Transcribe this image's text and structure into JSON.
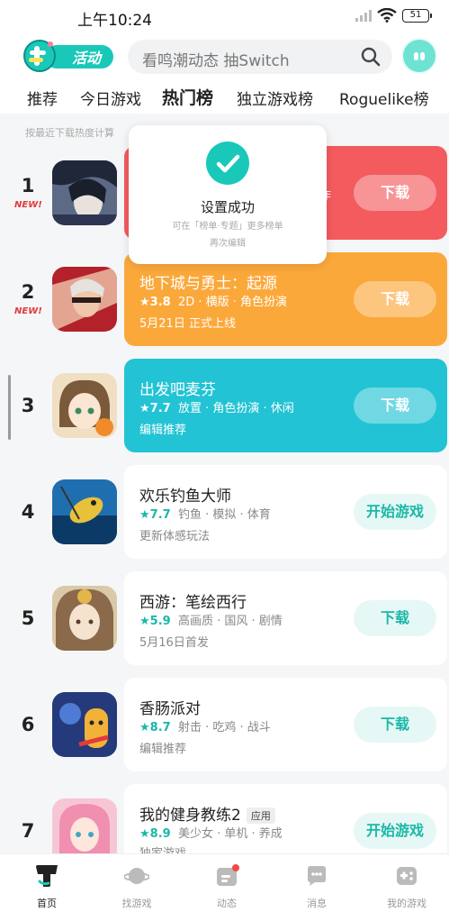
{
  "status_bar": {
    "time": "上午10:24",
    "battery": "51"
  },
  "header": {
    "activity_label": "活动",
    "search_placeholder": "看鸣潮动态 抽Switch"
  },
  "tabs": [
    {
      "label": "推荐"
    },
    {
      "label": "今日游戏"
    },
    {
      "label": "热门榜"
    },
    {
      "label": "独立游戏榜"
    },
    {
      "label": "Roguelike榜"
    }
  ],
  "subtitle": "按最近下载热度计算",
  "toast": {
    "title": "设置成功",
    "desc_line1": "可在「榜单·专题」更多榜单",
    "desc_line2": "再次编辑"
  },
  "games": [
    {
      "rank": "1",
      "new": "NEW!",
      "name": "",
      "score": "",
      "tags": "",
      "sub": "作",
      "button": "下载"
    },
    {
      "rank": "2",
      "new": "NEW!",
      "name": "地下城与勇士：起源",
      "score": "★3.8",
      "tags": "2D · 横版 · 角色扮演",
      "sub": "5月21日 正式上线",
      "button": "下载"
    },
    {
      "rank": "3",
      "new": "",
      "name": "出发吧麦芬",
      "score": "★7.7",
      "tags": "放置 · 角色扮演 · 休闲",
      "sub": "编辑推荐",
      "button": "下载"
    },
    {
      "rank": "4",
      "new": "",
      "name": "欢乐钓鱼大师",
      "score": "★7.7",
      "tags": "钓鱼 · 模拟 · 体育",
      "sub": "更新体感玩法",
      "button": "开始游戏"
    },
    {
      "rank": "5",
      "new": "",
      "name": "西游：笔绘西行",
      "score": "★5.9",
      "tags": "高画质 · 国风 · 剧情",
      "sub": "5月16日首发",
      "button": "下载"
    },
    {
      "rank": "6",
      "new": "",
      "name": "香肠派对",
      "score": "★8.7",
      "tags": "射击 · 吃鸡 · 战斗",
      "sub": "编辑推荐",
      "button": "下载"
    },
    {
      "rank": "7",
      "new": "",
      "name": "我的健身教练2",
      "app_tag": "应用",
      "score": "★8.9",
      "tags": "美少女 · 单机 · 养成",
      "sub": "独家游戏",
      "button": "开始游戏"
    }
  ],
  "bottom_nav": [
    {
      "label": "首页"
    },
    {
      "label": "找游戏"
    },
    {
      "label": "动态"
    },
    {
      "label": "消息"
    },
    {
      "label": "我的游戏"
    }
  ],
  "colors": {
    "accent": "#19c8b8",
    "card_red": "#f35b5f",
    "card_orange": "#fba83b",
    "card_cyan": "#22c3d4"
  }
}
